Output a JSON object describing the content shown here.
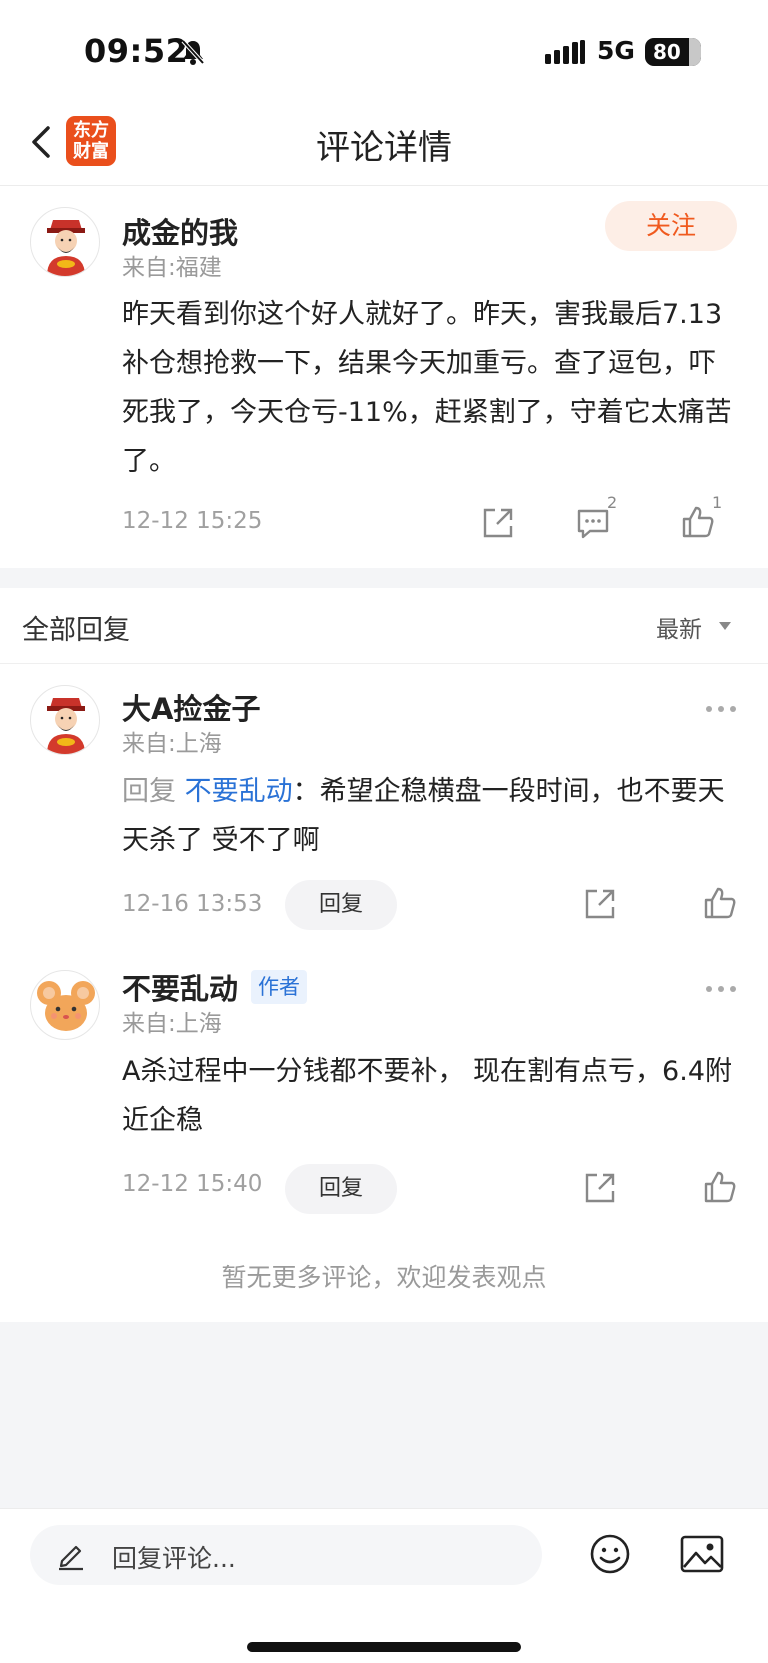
{
  "status_bar": {
    "time": "09:52",
    "network": "5G",
    "battery": "80"
  },
  "nav": {
    "title": "评论详情",
    "logo_line1": "东方",
    "logo_line2": "财富"
  },
  "main_comment": {
    "user": "成金的我",
    "location": "来自:福建",
    "follow_label": "关注",
    "text": "昨天看到你这个好人就好了。昨天，害我最后7.13补仓想抢救一下，结果今天加重亏。查了逗包，吓死我了，今天仓亏-11%，赶紧割了，守着它太痛苦了。",
    "time": "12-12 15:25",
    "reply_count": "2",
    "like_count": "1"
  },
  "replies_header": {
    "title": "全部回复",
    "sort": "最新"
  },
  "replies": [
    {
      "user": "大A捡金子",
      "location": "来自:上海",
      "prefix": "回复 ",
      "target": "不要乱动",
      "text": "：希望企稳横盘一段时间，也不要天天杀了  受不了啊",
      "time": "12-16 13:53",
      "reply_label": "回复"
    },
    {
      "user": "不要乱动",
      "badge": "作者",
      "location": "来自:上海",
      "text": "A杀过程中一分钱都不要补， 现在割有点亏，6.4附近企稳",
      "time": "12-12 15:40",
      "reply_label": "回复"
    }
  ],
  "footer_note": "暂无更多评论，欢迎发表观点",
  "bottom_bar": {
    "input_placeholder": "回复评论..."
  },
  "colors": {
    "accent": "#f05a1f",
    "link": "#2a72d6",
    "logo_bg": "#ea4f1c"
  },
  "icons": [
    "bell-slash-icon",
    "signal-icon",
    "back-icon",
    "share-icon",
    "comment-icon",
    "thumbs-up-icon",
    "more-icon",
    "pencil-icon",
    "emoji-icon",
    "image-icon"
  ]
}
